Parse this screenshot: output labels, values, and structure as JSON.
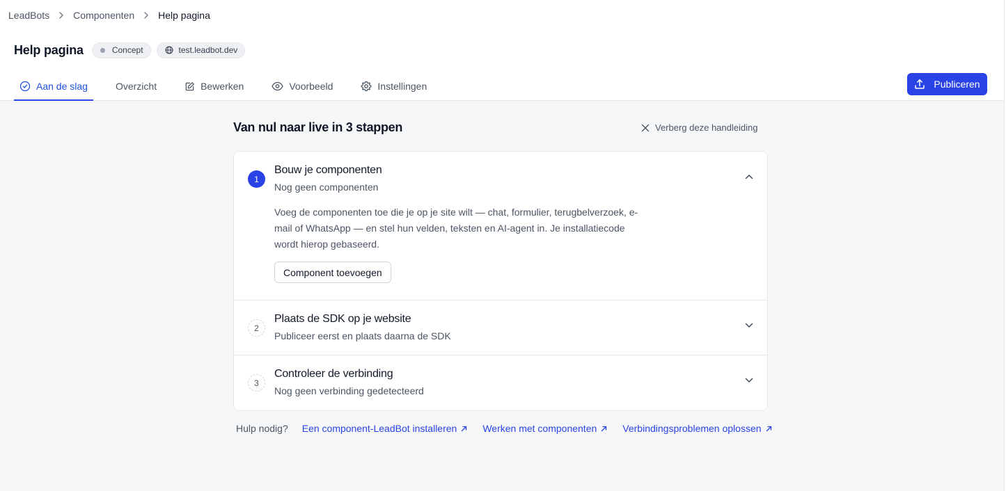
{
  "breadcrumb": {
    "items": [
      "LeadBots",
      "Componenten",
      "Help pagina"
    ]
  },
  "header": {
    "title": "Help pagina",
    "status_badge": "Concept",
    "domain_badge": "test.leadbot.dev"
  },
  "tabs": [
    {
      "label": "Aan de slag",
      "icon": "check-circle-icon",
      "active": true
    },
    {
      "label": "Overzicht",
      "icon": "",
      "active": false
    },
    {
      "label": "Bewerken",
      "icon": "edit-icon",
      "active": false
    },
    {
      "label": "Voorbeeld",
      "icon": "eye-icon",
      "active": false
    },
    {
      "label": "Instellingen",
      "icon": "gear-icon",
      "active": false
    }
  ],
  "publish_button": {
    "label": "Publiceren",
    "icon": "upload-icon"
  },
  "guide": {
    "title": "Van nul naar live in 3 stappen",
    "hide_label": "Verberg deze handleiding",
    "steps": [
      {
        "number": "1",
        "title": "Bouw je componenten",
        "subtitle": "Nog geen componenten",
        "expanded": true,
        "description": "Voeg de componenten toe die je op je site wilt — chat, formulier, terugbelverzoek, e-mail of WhatsApp — en stel hun velden, teksten en AI-agent in. Je installatiecode wordt hierop gebaseerd.",
        "button_label": "Component toevoegen"
      },
      {
        "number": "2",
        "title": "Plaats de SDK op je website",
        "subtitle": "Publiceer eerst en plaats daarna de SDK",
        "expanded": false
      },
      {
        "number": "3",
        "title": "Controleer de verbinding",
        "subtitle": "Nog geen verbinding gedetecteerd",
        "expanded": false
      }
    ]
  },
  "help": {
    "label": "Hulp nodig?",
    "links": [
      "Een component-LeadBot installeren",
      "Werken met componenten",
      "Verbindingsproblemen oplossen"
    ]
  },
  "colors": {
    "accent": "#2a43e6",
    "background": "#f6f7f9",
    "border": "#e5e7eb"
  }
}
